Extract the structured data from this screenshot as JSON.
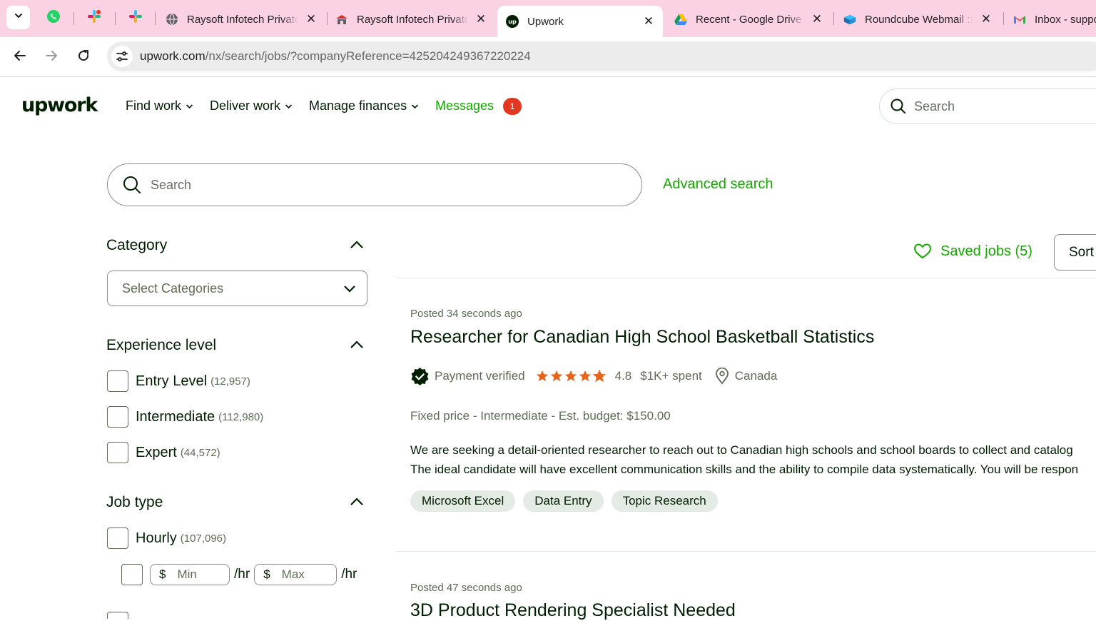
{
  "browser": {
    "tabs": [
      {
        "title": "Raysoft Infotech Private Limited",
        "icon": "globe-icon"
      },
      {
        "title": "Raysoft Infotech Private Limited",
        "icon": "raysoft-icon"
      },
      {
        "title": "Upwork",
        "icon": "upwork-icon",
        "active": true
      },
      {
        "title": "Recent - Google Drive",
        "icon": "google-drive-icon"
      },
      {
        "title": "Roundcube Webmail :: Inbox",
        "icon": "roundcube-icon"
      },
      {
        "title": "Inbox - support",
        "icon": "gmail-icon"
      }
    ],
    "pinned_tabs": [
      "whatsapp-icon",
      "slack-icon",
      "slack-icon"
    ],
    "close_glyph": "✕",
    "url_host": "upwork.com",
    "url_path": "/nx/search/jobs/?companyReference=425204249367220224"
  },
  "header": {
    "logo": "upwork",
    "nav": [
      "Find work",
      "Deliver work",
      "Manage finances"
    ],
    "messages_label": "Messages",
    "messages_count": "1",
    "search_placeholder": "Search"
  },
  "search": {
    "placeholder": "Search",
    "advanced_label": "Advanced search"
  },
  "filters": {
    "category": {
      "title": "Category",
      "placeholder": "Select Categories"
    },
    "experience": {
      "title": "Experience level",
      "options": [
        {
          "label": "Entry Level",
          "count": "(12,957)"
        },
        {
          "label": "Intermediate",
          "count": "(112,980)"
        },
        {
          "label": "Expert",
          "count": "(44,572)"
        }
      ]
    },
    "job_type": {
      "title": "Job type",
      "hourly": {
        "label": "Hourly",
        "count": "(107,096)"
      },
      "currency": "$",
      "min_placeholder": "Min",
      "max_placeholder": "Max",
      "per_hour": "/hr"
    }
  },
  "results": {
    "saved_jobs_label": "Saved jobs (5)",
    "sort_label": "Sort",
    "jobs": [
      {
        "posted": "Posted 34 seconds ago",
        "title": "Researcher for Canadian High School Basketball Statistics",
        "payment": "Payment verified",
        "rating": "4.8",
        "rating_value": 4.8,
        "spent": "$1K+ spent",
        "location": "Canada",
        "job_type": "Fixed price - Intermediate - Est. budget: $150.00",
        "description_line1": "We are seeking a detail-oriented researcher to reach out to Canadian high schools and school boards to collect and catalog",
        "description_line2": "The ideal candidate will have excellent communication skills and the ability to compile data systematically. You will be respon",
        "tags": [
          "Microsoft Excel",
          "Data Entry",
          "Topic Research"
        ]
      },
      {
        "posted": "Posted 47 seconds ago",
        "title": "3D Product Rendering Specialist Needed"
      }
    ]
  },
  "colors": {
    "accent": "#14a800",
    "text": "#001e00",
    "muted": "#5e6d55",
    "tag_bg": "#e4ebe4",
    "badge": "#e3381f",
    "star": "#e6651a",
    "tab_strip": "#fbd2e4"
  }
}
